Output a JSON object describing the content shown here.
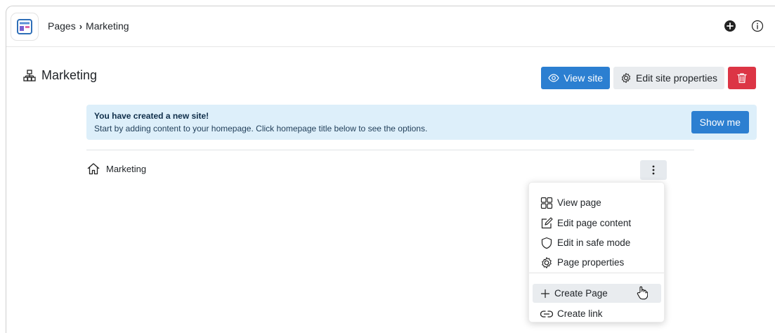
{
  "breadcrumb": {
    "root": "Pages",
    "separator": "›",
    "current": "Marketing"
  },
  "topbar": {
    "icons": [
      "plus-circle-icon",
      "info-icon"
    ]
  },
  "header": {
    "title": "Marketing",
    "view_site": "View site",
    "edit_properties": "Edit site properties"
  },
  "alert": {
    "title": "You have created a new site!",
    "text": "Start by adding content to your homepage. Click homepage title below to see the options.",
    "button": "Show me"
  },
  "page_row": {
    "label": "Marketing"
  },
  "menu": {
    "items": [
      {
        "label": "View page",
        "icon": "grid-icon"
      },
      {
        "label": "Edit page content",
        "icon": "edit-icon"
      },
      {
        "label": "Edit in safe mode",
        "icon": "shield-icon"
      },
      {
        "label": "Page properties",
        "icon": "gear-icon"
      },
      {
        "label": "Create Page",
        "icon": "plus-icon"
      },
      {
        "label": "Create link",
        "icon": "link-icon"
      }
    ]
  },
  "colors": {
    "primary": "#2c7fd1",
    "danger": "#dc3545",
    "alert_bg": "#ddeffa",
    "light": "#e9ecef"
  }
}
